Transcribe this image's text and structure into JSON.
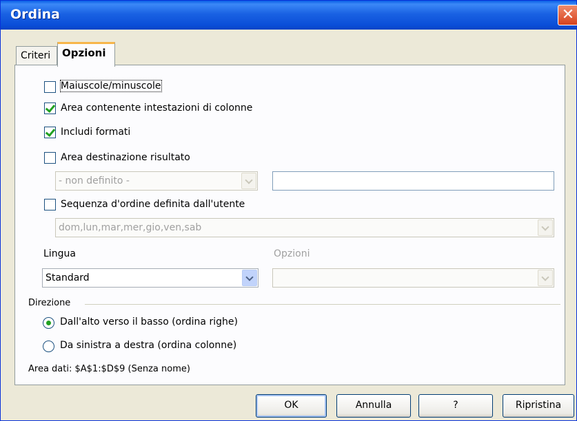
{
  "window": {
    "title": "Ordina",
    "close_symbol": "✕"
  },
  "tabs": [
    {
      "label": "Criteri",
      "active": false
    },
    {
      "label": "Opzioni",
      "active": true
    }
  ],
  "options": {
    "case_sensitive": {
      "label": "Maiuscole/minuscole",
      "checked": false
    },
    "has_headers": {
      "label": "Area contenente intestazioni di colonne",
      "checked": true
    },
    "include_formats": {
      "label": "Includi formati",
      "checked": true
    },
    "copy_results": {
      "label": "Area destinazione risultato",
      "checked": false
    },
    "output_combo": {
      "value": "- non definito -",
      "enabled": false
    },
    "output_field": {
      "value": ""
    },
    "custom_order": {
      "label": "Sequenza d'ordine definita dall'utente",
      "checked": false
    },
    "custom_order_combo": {
      "value": "dom,lun,mar,mer,gio,ven,sab",
      "enabled": false
    },
    "language": {
      "label": "Lingua",
      "value": "Standard"
    },
    "language_options": {
      "label": "Opzioni",
      "value": "",
      "enabled": false
    }
  },
  "direction": {
    "label": "Direzione",
    "top_to_bottom": {
      "label": "Dall'alto verso il basso (ordina righe)",
      "selected": true
    },
    "left_to_right": {
      "label": "Da sinistra a destra (ordina colonne)",
      "selected": false
    }
  },
  "data_area": "Area dati: $A$1:$D$9 (Senza nome)",
  "buttons": {
    "ok": "OK",
    "cancel": "Annulla",
    "help": "?",
    "reset": "Ripristina"
  },
  "colors": {
    "titlebar": "#0a4ed8",
    "dialog_bg": "#ece9d8",
    "check_accent": "#21a121",
    "tab_highlight": "#f7b64a"
  }
}
